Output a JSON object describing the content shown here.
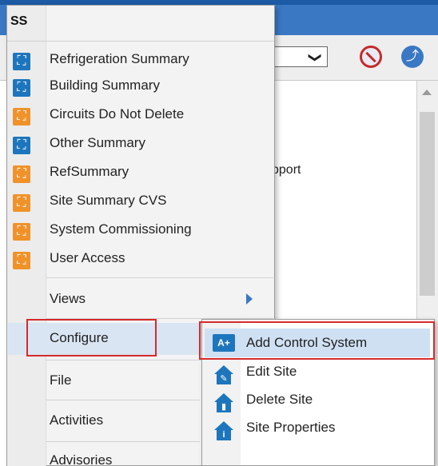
{
  "background": {
    "support_text": "pport",
    "select_chevron": "❯"
  },
  "menu": {
    "title": "SS",
    "summary_items": [
      {
        "label": "Refrigeration Summary",
        "icon": "blue-tree-icon"
      },
      {
        "label": "Building Summary",
        "icon": "blue-tree-icon"
      },
      {
        "label": "Circuits Do Not Delete",
        "icon": "orange-tree-icon"
      },
      {
        "label": "Other Summary",
        "icon": "blue-tree-icon"
      },
      {
        "label": "RefSummary",
        "icon": "orange-tree-icon"
      },
      {
        "label": "Site Summary CVS",
        "icon": "orange-tree-icon"
      },
      {
        "label": "System Commissioning",
        "icon": "orange-tree-icon"
      },
      {
        "label": "User Access",
        "icon": "orange-tree-icon"
      }
    ],
    "views_label": "Views",
    "configure_label": "Configure",
    "file_label": "File",
    "activities_label": "Activities",
    "advisories_label": "Advisories"
  },
  "submenu": {
    "add_control_system_label": "Add Control System",
    "edit_site_label": "Edit Site",
    "delete_site_label": "Delete Site",
    "site_properties_label": "Site Properties"
  },
  "colors": {
    "accent_blue": "#1d76bd",
    "accent_orange": "#f0922a",
    "highlight_red": "#d62b2b",
    "selection": "#d9e5f2"
  }
}
